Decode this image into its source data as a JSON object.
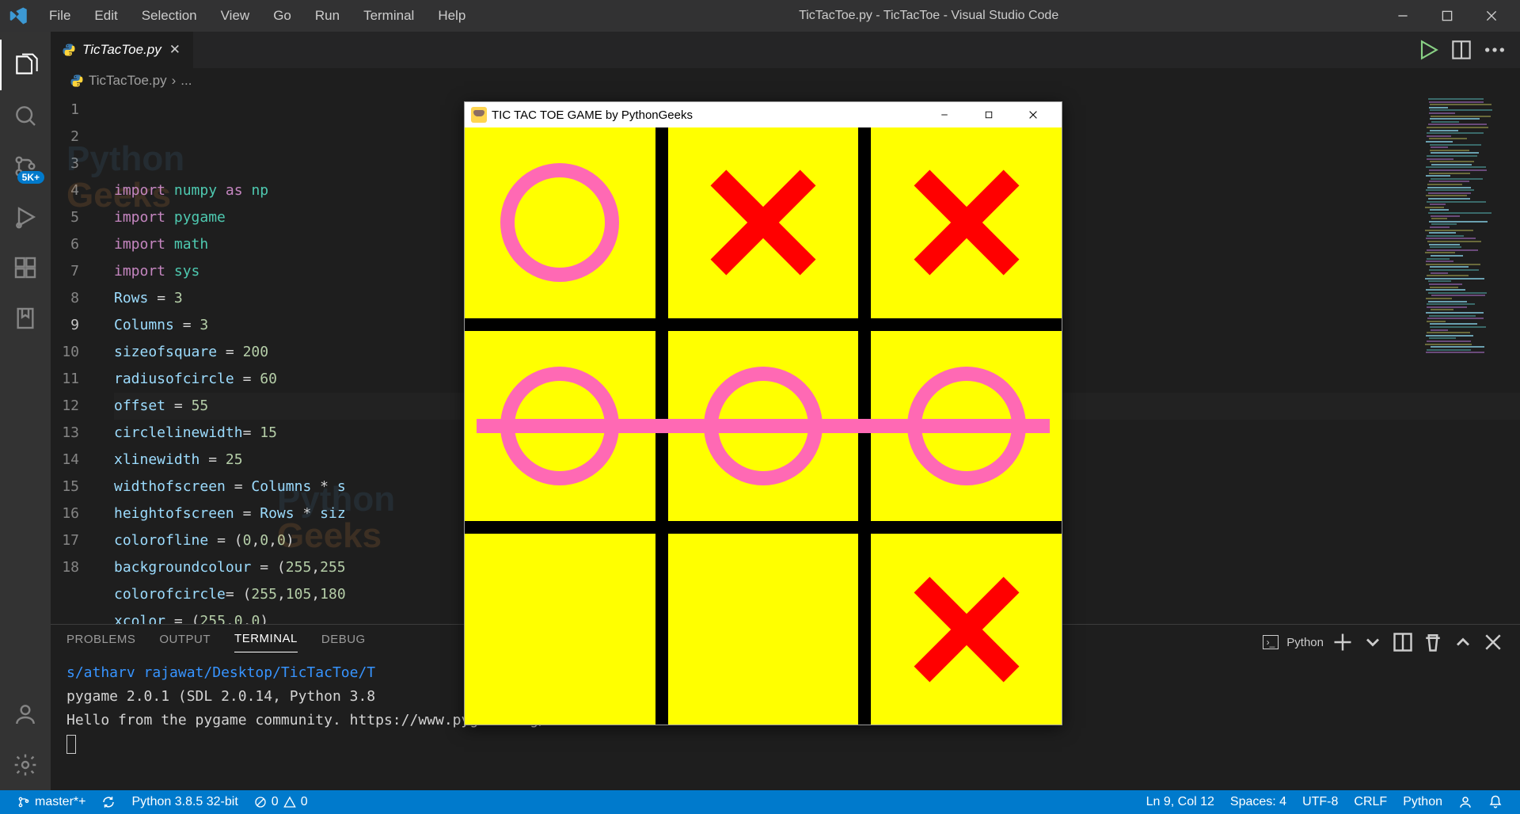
{
  "window_title": "TicTacToe.py - TicTacToe - Visual Studio Code",
  "menu": [
    "File",
    "Edit",
    "Selection",
    "View",
    "Go",
    "Run",
    "Terminal",
    "Help"
  ],
  "activity_badge": "5K+",
  "tab": {
    "name": "TicTacToe.py"
  },
  "breadcrumb": {
    "file": "TicTacToe.py",
    "tail": "..."
  },
  "code": {
    "lines": [
      {
        "n": 1,
        "tokens": [
          [
            "kw",
            "import"
          ],
          [
            "sp",
            " "
          ],
          [
            "mod",
            "numpy"
          ],
          [
            "sp",
            " "
          ],
          [
            "kw",
            "as"
          ],
          [
            "sp",
            " "
          ],
          [
            "mod",
            "np"
          ]
        ]
      },
      {
        "n": 2,
        "tokens": [
          [
            "kw",
            "import"
          ],
          [
            "sp",
            " "
          ],
          [
            "mod",
            "pygame"
          ]
        ]
      },
      {
        "n": 3,
        "tokens": [
          [
            "kw",
            "import"
          ],
          [
            "sp",
            " "
          ],
          [
            "mod",
            "math"
          ]
        ]
      },
      {
        "n": 4,
        "tokens": [
          [
            "kw",
            "import"
          ],
          [
            "sp",
            " "
          ],
          [
            "mod",
            "sys"
          ]
        ]
      },
      {
        "n": 5,
        "tokens": [
          [
            "var",
            "Rows"
          ],
          [
            "sp",
            " "
          ],
          [
            "op",
            "="
          ],
          [
            "sp",
            " "
          ],
          [
            "num",
            "3"
          ]
        ]
      },
      {
        "n": 6,
        "tokens": [
          [
            "var",
            "Columns"
          ],
          [
            "sp",
            " "
          ],
          [
            "op",
            "="
          ],
          [
            "sp",
            " "
          ],
          [
            "num",
            "3"
          ]
        ]
      },
      {
        "n": 7,
        "tokens": [
          [
            "var",
            "sizeofsquare"
          ],
          [
            "sp",
            " "
          ],
          [
            "op",
            "="
          ],
          [
            "sp",
            " "
          ],
          [
            "num",
            "200"
          ]
        ]
      },
      {
        "n": 8,
        "tokens": [
          [
            "var",
            "radiusofcircle"
          ],
          [
            "sp",
            " "
          ],
          [
            "op",
            "="
          ],
          [
            "sp",
            " "
          ],
          [
            "num",
            "60"
          ]
        ]
      },
      {
        "n": 9,
        "tokens": [
          [
            "var",
            "offset"
          ],
          [
            "sp",
            " "
          ],
          [
            "op",
            "="
          ],
          [
            "sp",
            " "
          ],
          [
            "num",
            "55"
          ]
        ],
        "current": true
      },
      {
        "n": 10,
        "tokens": [
          [
            "var",
            "circlelinewidth"
          ],
          [
            "op",
            "="
          ],
          [
            "sp",
            " "
          ],
          [
            "num",
            "15"
          ]
        ]
      },
      {
        "n": 11,
        "tokens": [
          [
            "var",
            "xlinewidth"
          ],
          [
            "sp",
            " "
          ],
          [
            "op",
            "="
          ],
          [
            "sp",
            " "
          ],
          [
            "num",
            "25"
          ]
        ]
      },
      {
        "n": 12,
        "tokens": [
          [
            "var",
            "widthofscreen"
          ],
          [
            "sp",
            " "
          ],
          [
            "op",
            "="
          ],
          [
            "sp",
            " "
          ],
          [
            "var",
            "Columns"
          ],
          [
            "sp",
            " "
          ],
          [
            "op",
            "*"
          ],
          [
            "sp",
            " "
          ],
          [
            "var",
            "s"
          ]
        ]
      },
      {
        "n": 13,
        "tokens": [
          [
            "var",
            "heightofscreen"
          ],
          [
            "sp",
            " "
          ],
          [
            "op",
            "="
          ],
          [
            "sp",
            " "
          ],
          [
            "var",
            "Rows"
          ],
          [
            "sp",
            " "
          ],
          [
            "op",
            "*"
          ],
          [
            "sp",
            " "
          ],
          [
            "var",
            "siz"
          ]
        ]
      },
      {
        "n": 14,
        "tokens": [
          [
            "var",
            "colorofline"
          ],
          [
            "sp",
            " "
          ],
          [
            "op",
            "="
          ],
          [
            "sp",
            " "
          ],
          [
            "op",
            "("
          ],
          [
            "num",
            "0"
          ],
          [
            "op",
            ","
          ],
          [
            "num",
            "0"
          ],
          [
            "op",
            ","
          ],
          [
            "num",
            "0"
          ],
          [
            "op",
            ")"
          ]
        ]
      },
      {
        "n": 15,
        "tokens": [
          [
            "var",
            "backgroundcolour"
          ],
          [
            "sp",
            " "
          ],
          [
            "op",
            "="
          ],
          [
            "sp",
            " "
          ],
          [
            "op",
            "("
          ],
          [
            "num",
            "255"
          ],
          [
            "op",
            ","
          ],
          [
            "num",
            "255"
          ]
        ]
      },
      {
        "n": 16,
        "tokens": [
          [
            "var",
            "colorofcircle"
          ],
          [
            "op",
            "="
          ],
          [
            "sp",
            " "
          ],
          [
            "op",
            "("
          ],
          [
            "num",
            "255"
          ],
          [
            "op",
            ","
          ],
          [
            "num",
            "105"
          ],
          [
            "op",
            ","
          ],
          [
            "num",
            "180"
          ]
        ]
      },
      {
        "n": 17,
        "tokens": [
          [
            "var",
            "xcolor"
          ],
          [
            "sp",
            " "
          ],
          [
            "op",
            "="
          ],
          [
            "sp",
            " "
          ],
          [
            "op",
            "("
          ],
          [
            "num",
            "255"
          ],
          [
            "op",
            ","
          ],
          [
            "num",
            "0"
          ],
          [
            "op",
            ","
          ],
          [
            "num",
            "0"
          ],
          [
            "op",
            ")"
          ]
        ]
      },
      {
        "n": 18,
        "tokens": []
      }
    ]
  },
  "panel": {
    "tabs": [
      "PROBLEMS",
      "OUTPUT",
      "TERMINAL",
      "DEBUG"
    ],
    "active_tab": 2,
    "shell_label": "Python",
    "lines": [
      {
        "type": "path",
        "text": "s/atharv rajawat/Desktop/TicTacToe/T"
      },
      {
        "type": "text",
        "text": "pygame 2.0.1 (SDL 2.0.14, Python 3.8"
      },
      {
        "type": "text",
        "text": "Hello from the pygame community. https://www.pygame.org/contribute.html"
      }
    ]
  },
  "status": {
    "branch": "master*+",
    "interpreter": "Python 3.8.5 32-bit",
    "errors": "0",
    "warnings": "0",
    "ln_col": "Ln 9, Col 12",
    "spaces": "Spaces: 4",
    "encoding": "UTF-8",
    "eol": "CRLF",
    "lang": "Python"
  },
  "game": {
    "title": "TIC TAC TOE GAME by PythonGeeks",
    "board": [
      [
        "O",
        "X",
        "X"
      ],
      [
        "O",
        "O",
        "O"
      ],
      [
        "",
        "",
        "X"
      ]
    ],
    "win_line_row": 1
  },
  "watermark": {
    "line1": "Python",
    "line2": "Geeks"
  }
}
